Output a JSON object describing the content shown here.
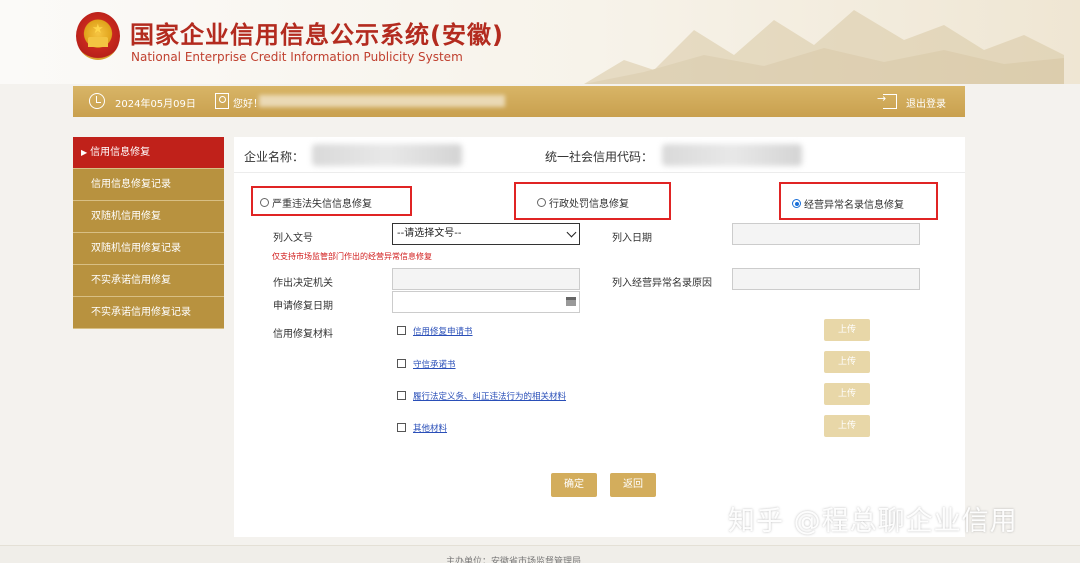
{
  "header": {
    "title": "国家企业信用信息公示系统(安徽)",
    "subtitle": "National Enterprise Credit Information Publicity System"
  },
  "topbar": {
    "date": "2024年05月09日",
    "greeting": "您好！",
    "logout": "退出登录"
  },
  "sidebar": {
    "items": [
      {
        "label": "信用信息修复",
        "active": true
      },
      {
        "label": "信用信息修复记录"
      },
      {
        "label": "双随机信用修复"
      },
      {
        "label": "双随机信用修复记录"
      },
      {
        "label": "不实承诺信用修复"
      },
      {
        "label": "不实承诺信用修复记录"
      }
    ]
  },
  "company": {
    "name_label": "企业名称：",
    "code_label": "统一社会信用代码："
  },
  "repair_types": [
    {
      "label": "严重违法失信信息修复",
      "checked": false
    },
    {
      "label": "行政处罚信息修复",
      "checked": false
    },
    {
      "label": "经营异常名录信息修复",
      "checked": true
    }
  ],
  "form": {
    "doc_label": "列入文号",
    "doc_select": "--请选择文号--",
    "date_label": "列入日期",
    "note": "仅支持市场监管部门作出的经营异常信息修复",
    "authority_label": "作出决定机关",
    "reason_label": "列入经营异常名录原因",
    "apply_date_label": "申请修复日期",
    "materials_label": "信用修复材料"
  },
  "materials": [
    {
      "label": "信用修复申请书",
      "upload": "上传"
    },
    {
      "label": "守信承诺书",
      "upload": "上传"
    },
    {
      "label": "履行法定义务、纠正违法行为的相关材料",
      "upload": "上传"
    },
    {
      "label": "其他材料",
      "upload": "上传"
    }
  ],
  "actions": {
    "confirm": "确定",
    "back": "返回"
  },
  "watermark": "知乎 @程总聊企业信用",
  "footer": "主办单位：安徽省市场监督管理局",
  "colors": {
    "brand_red": "#b32b1f",
    "gold": "#c9a04e",
    "sidebar_gold": "#b8923f",
    "active_red": "#c0211a",
    "highlight_border": "#e02424",
    "link_blue": "#2a4fb8"
  }
}
